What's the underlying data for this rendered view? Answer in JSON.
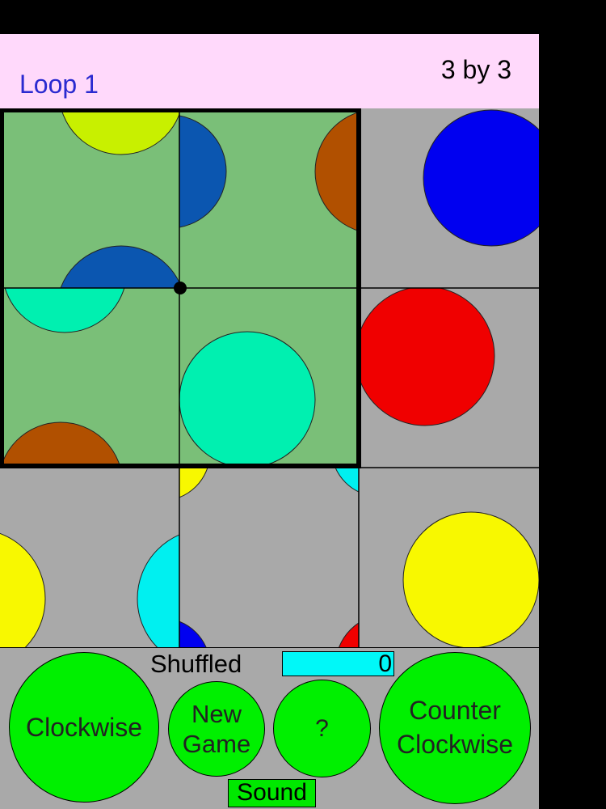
{
  "header": {
    "loop_label": "Loop 1",
    "size_label": "3 by 3",
    "background": "#ffd9fb"
  },
  "board": {
    "grid": "3x3",
    "active_loop_background": "#7abf78",
    "tile_background": "#a9a9a9",
    "colors": {
      "lime": "#c8f000",
      "dark_blue": "#0b56b0",
      "brown": "#b15000",
      "aqua_green": "#00f0b0",
      "blue": "#0000f0",
      "red": "#f00000",
      "yellow": "#f8f800",
      "cyan": "#00f0f0"
    }
  },
  "controls": {
    "shuffled_label": "Shuffled",
    "shuffled_count": "0",
    "clockwise_label": "Clockwise",
    "new_game_label": "New Game",
    "help_label": "?",
    "counter_clockwise_label": "Counter Clockwise",
    "sound_label": "Sound",
    "button_color": "#00f000",
    "counter_color": "#00f8f8"
  }
}
